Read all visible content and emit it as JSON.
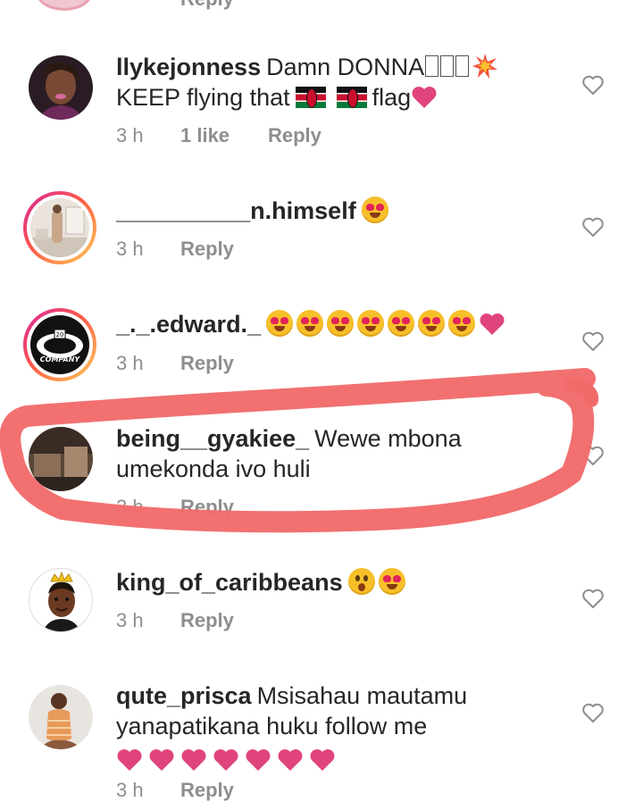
{
  "partial_top_reply": "Reply",
  "comments": [
    {
      "username": "llykejonness",
      "text_before": "Damn DONNA",
      "text_mid": "KEEP flying that",
      "text_after": "flag",
      "time": "3 h",
      "likes": "1 like",
      "reply": "Reply",
      "avatar_ring": false,
      "avatar_icon": "woman-portrait-avatar"
    },
    {
      "username": "__________n.himself",
      "time": "3 h",
      "reply": "Reply",
      "avatar_ring": true,
      "avatar_icon": "room-photo-avatar"
    },
    {
      "username": "_._.edward._",
      "time": "3 h",
      "reply": "Reply",
      "avatar_ring": true,
      "avatar_icon": "company-logo-avatar",
      "logo_text": "COMPANY",
      "logo_number": "20"
    },
    {
      "username": "being__gyakiee_",
      "text": "Wewe mbona umekonda ivo huli",
      "time": "3 h",
      "reply": "Reply",
      "avatar_ring": false,
      "avatar_icon": "bedroom-photo-avatar"
    },
    {
      "username": "king_of_caribbeans",
      "time": "3 h",
      "reply": "Reply",
      "avatar_ring": false,
      "avatar_icon": "crowned-cartoon-avatar"
    },
    {
      "username": "qute_prisca",
      "text": "Msisahau mautamu yanapatikana huku follow me",
      "time": "3 h",
      "reply": "Reply",
      "avatar_ring": false,
      "avatar_icon": "woman-photo-avatar"
    }
  ],
  "colors": {
    "meta_gray": "#8e8e8e",
    "text": "#262626",
    "heart_pink": "#e0447c",
    "annotation_red": "#f26b6b"
  }
}
